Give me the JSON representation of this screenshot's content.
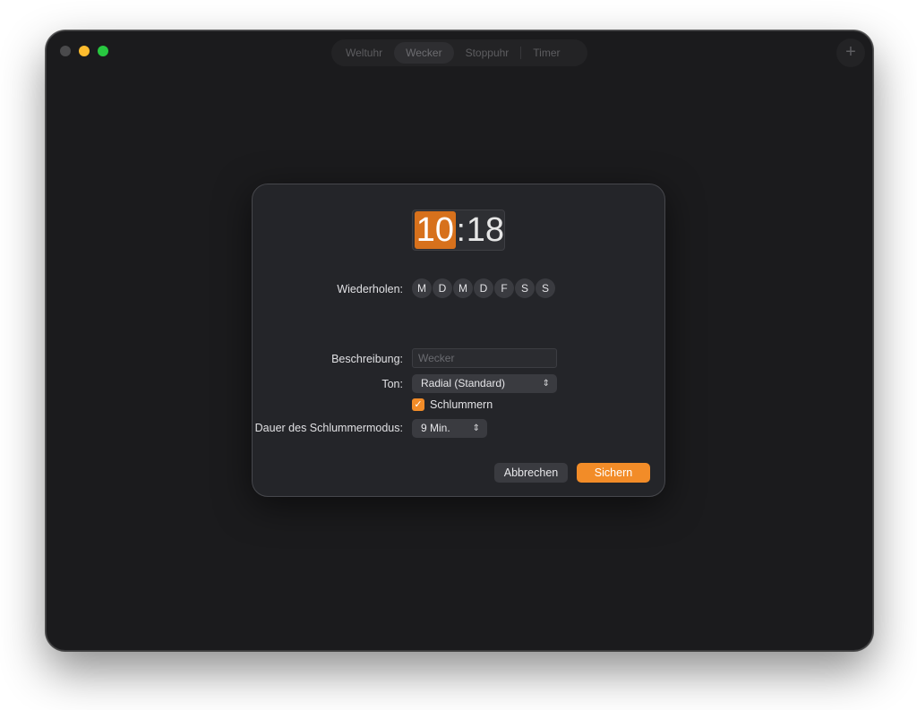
{
  "tabs": [
    {
      "label": "Weltuhr",
      "active": false
    },
    {
      "label": "Wecker",
      "active": true
    },
    {
      "label": "Stoppuhr",
      "active": false
    },
    {
      "label": "Timer",
      "active": false
    }
  ],
  "toolbar": {
    "add_label": "+"
  },
  "dialog": {
    "time": {
      "hour": "10",
      "separator": ":",
      "minute": "18"
    },
    "repeat": {
      "label": "Wiederholen:",
      "days": [
        "M",
        "D",
        "M",
        "D",
        "F",
        "S",
        "S"
      ]
    },
    "description": {
      "label": "Beschreibung:",
      "value": "",
      "placeholder": "Wecker"
    },
    "sound": {
      "label": "Ton:",
      "value": "Radial (Standard)"
    },
    "snooze": {
      "label": "Schlummern",
      "checked": true,
      "check_glyph": "✓"
    },
    "snooze_duration": {
      "label": "Dauer des Schlummermodus:",
      "value": "9 Min."
    },
    "buttons": {
      "cancel": "Abbrechen",
      "save": "Sichern"
    }
  },
  "colors": {
    "accent": "#f28c28",
    "time_selection": "#d7711c",
    "window_bg": "#1b1b1d",
    "sheet_bg": "#242529"
  },
  "icons": {
    "popup_chevron": "up-down-chevron-icon",
    "add": "plus-icon"
  }
}
